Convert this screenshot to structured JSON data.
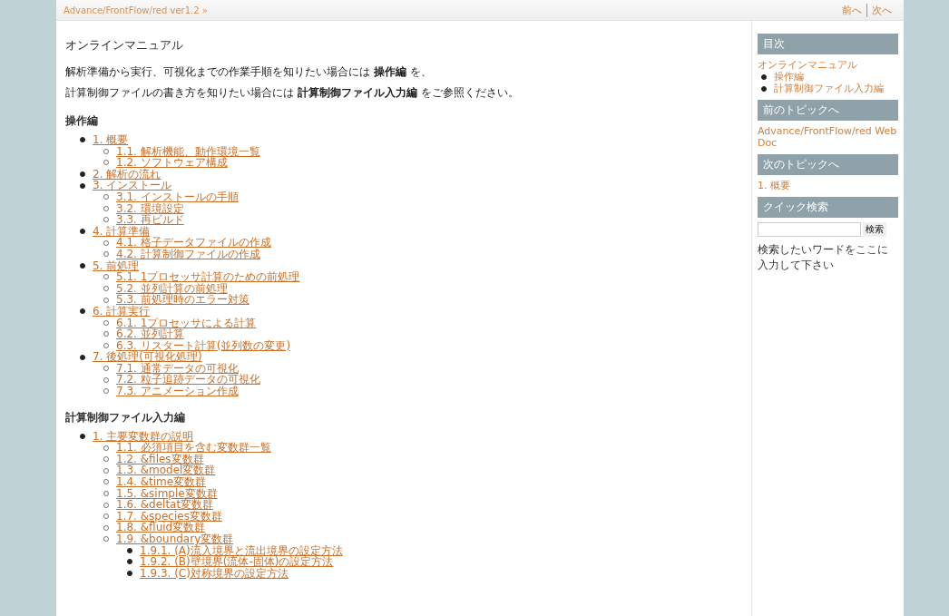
{
  "header": {
    "breadcrumb": "Advance/FrontFlow/red ver1.2 »",
    "nav": [
      {
        "label": "前へ"
      },
      {
        "label": "次へ"
      }
    ]
  },
  "main": {
    "title": "オンラインマニュアル",
    "intro": [
      "解析準備から実行、可視化までの作業手順を知りたい場合には **操作編** を、",
      "計算制御ファイルの書き方を知りたい場合には **計算制御ファイル入力編** をご参照ください。"
    ],
    "sections": [
      {
        "heading": "操作編",
        "items": [
          {
            "label": "1. 概要",
            "children": [
              {
                "label": "1.1. 解析機能、動作環境一覧"
              },
              {
                "label": "1.2. ソフトウェア構成"
              }
            ]
          },
          {
            "label": "2. 解析の流れ"
          },
          {
            "label": "3. インストール",
            "children": [
              {
                "label": "3.1. インストールの手順"
              },
              {
                "label": "3.2. 環境設定"
              },
              {
                "label": "3.3. 再ビルド"
              }
            ]
          },
          {
            "label": "4. 計算準備",
            "children": [
              {
                "label": "4.1. 格子データファイルの作成"
              },
              {
                "label": "4.2. 計算制御ファイルの作成"
              }
            ]
          },
          {
            "label": "5. 前処理",
            "children": [
              {
                "label": "5.1. 1プロセッサ計算のための前処理"
              },
              {
                "label": "5.2. 並列計算の前処理"
              },
              {
                "label": "5.3. 前処理時のエラー対策"
              }
            ]
          },
          {
            "label": "6. 計算実行",
            "children": [
              {
                "label": "6.1. 1プロセッサによる計算"
              },
              {
                "label": "6.2. 並列計算"
              },
              {
                "label": "6.3. リスタート計算(並列数の変更)"
              }
            ]
          },
          {
            "label": "7. 後処理(可視化処理)",
            "children": [
              {
                "label": "7.1. 通常データの可視化"
              },
              {
                "label": "7.2. 粒子追跡データの可視化"
              },
              {
                "label": "7.3. アニメーション作成"
              }
            ]
          }
        ]
      },
      {
        "heading": "計算制御ファイル入力編",
        "items": [
          {
            "label": "1. 主要変数群の説明",
            "children": [
              {
                "label": "1.1. 必須項目を含む変数群一覧"
              },
              {
                "label": "1.2. &files変数群"
              },
              {
                "label": "1.3. &model変数群"
              },
              {
                "label": "1.4. &time変数群"
              },
              {
                "label": "1.5. &simple変数群"
              },
              {
                "label": "1.6. &deltat変数群"
              },
              {
                "label": "1.7. &species変数群"
              },
              {
                "label": "1.8. &fluid変数群"
              },
              {
                "label": "1.9. &boundary変数群",
                "children": [
                  {
                    "label": "1.9.1. (A)流入境界と流出境界の設定方法"
                  },
                  {
                    "label": "1.9.2. (B)壁境界(流体-固体)の設定方法"
                  },
                  {
                    "label": "1.9.3. (C)対称境界の設定方法"
                  }
                ]
              }
            ]
          }
        ]
      }
    ]
  },
  "sidebar": {
    "toc": {
      "heading": "目次",
      "root": "オンラインマニュアル",
      "items": [
        "操作編",
        "計算制御ファイル入力編"
      ]
    },
    "prev": {
      "heading": "前のトピックへ",
      "link": "Advance/FrontFlow/red Web Doc"
    },
    "next": {
      "heading": "次のトピックへ",
      "link": "1. 概要"
    },
    "search": {
      "heading": "クイック検索",
      "button": "検索",
      "hint": "検索したいワードをここに入力して下さい"
    }
  }
}
